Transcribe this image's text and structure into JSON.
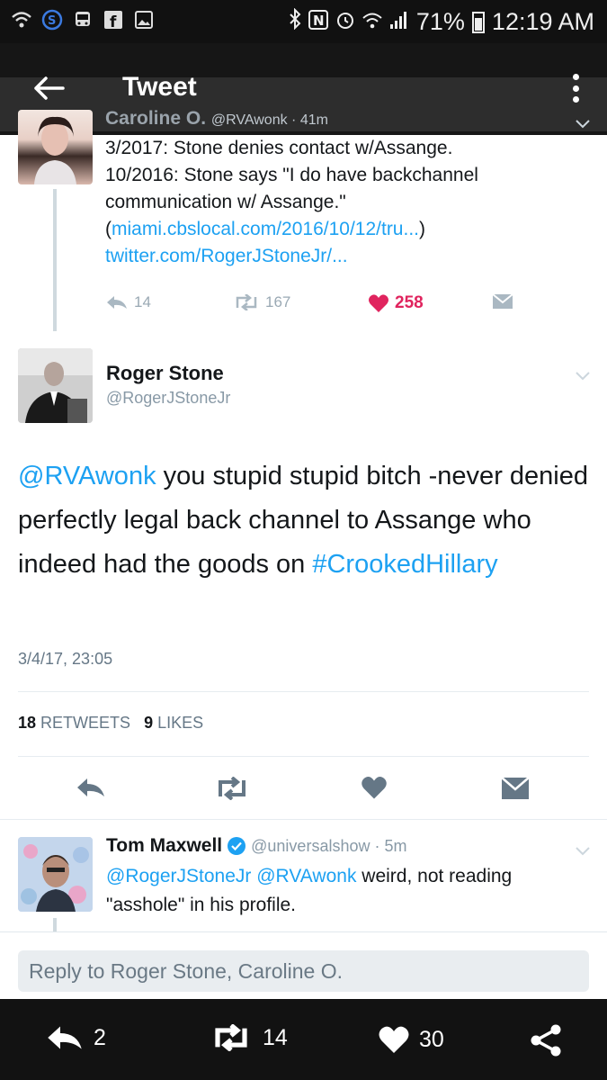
{
  "status_bar": {
    "battery": "71%",
    "time": "12:19 AM"
  },
  "app_bar": {
    "title": "Tweet"
  },
  "parent_tweet": {
    "name": "Caroline O.",
    "handle": "@RVAwonk · 41m",
    "text_line1": "3/2017: Stone denies contact w/Assange.",
    "text_line2": "10/2016: Stone says \"I do have backchannel communication w/ Assange.\"(",
    "link1": "miami.cbslocal.com/2016/10/12/tru...",
    "text_mid": ") ",
    "link2": "twitter.com/RogerJStoneJr/...",
    "replies": "14",
    "retweets": "167",
    "likes": "258"
  },
  "main_tweet": {
    "name": "Roger Stone",
    "handle": "@RogerJStoneJr",
    "mention": "@RVAwonk",
    "text": " you stupid stupid bitch -never denied perfectly legal back channel to Assange who indeed had the goods on ",
    "hashtag": "#CrookedHillary",
    "timestamp": "3/4/17, 23:05",
    "retweet_count": "18",
    "retweet_label": "RETWEETS",
    "like_count": "9",
    "like_label": "LIKES"
  },
  "reply_tweet": {
    "name": "Tom Maxwell",
    "handle": "@universalshow · 5m",
    "mention1": "@RogerJStoneJr",
    "mention2": "@RVAwonk",
    "text": " weird, not reading \"asshole\" in his profile."
  },
  "reply_box": {
    "placeholder": "Reply to Roger Stone, Caroline O."
  },
  "bottom_bar": {
    "replies": "2",
    "retweets": "14",
    "likes": "30"
  },
  "colors": {
    "accent": "#1da1f2",
    "like": "#e0245e",
    "action_icon": "#657786"
  }
}
